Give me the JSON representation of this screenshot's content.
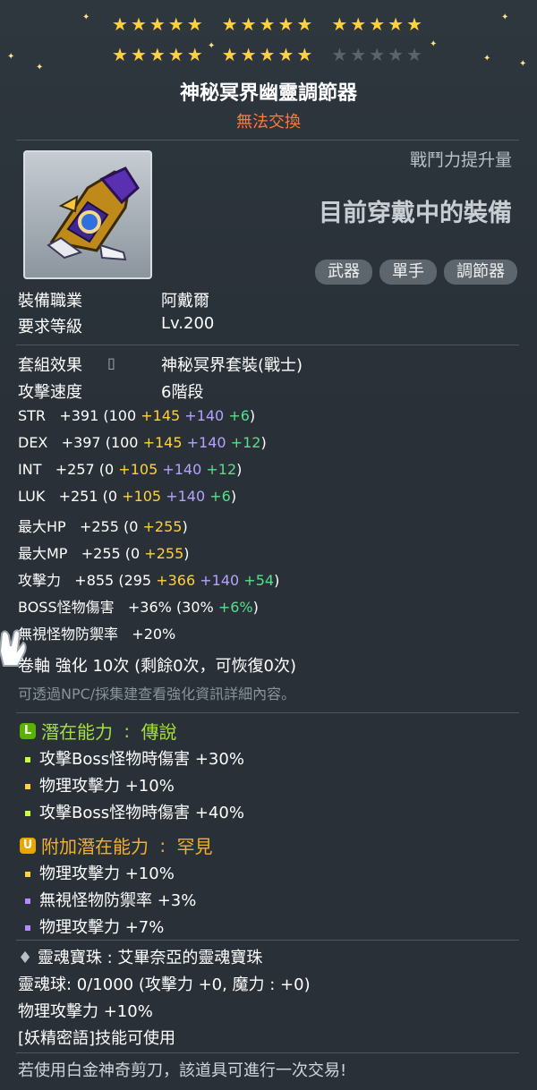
{
  "stars": {
    "row1_filled": 15,
    "row2_filled": 10,
    "row2_empty": 5
  },
  "item": {
    "name": "神秘冥界幽靈調節器",
    "trade_status": "無法交換"
  },
  "header": {
    "power_label": "戰鬥力提升量",
    "current_equipped": "目前穿戴中的裝備",
    "tags": [
      "武器",
      "單手",
      "調節器"
    ]
  },
  "requirements": {
    "job_label": "裝備職業",
    "job_value": "阿戴爾",
    "level_label": "要求等級",
    "level_value": "Lv.200"
  },
  "info": {
    "set_label": "套組效果",
    "set_value": "神秘冥界套裝(戰士)",
    "speed_label": "攻擊速度",
    "speed_value": "6階段"
  },
  "stats": [
    {
      "label": "STR",
      "total": "+391",
      "base": "(100",
      "a": "+145",
      "b": "+140",
      "c": "+6",
      "end": ")"
    },
    {
      "label": "DEX",
      "total": "+397",
      "base": "(100",
      "a": "+145",
      "b": "+140",
      "c": "+12",
      "end": ")"
    },
    {
      "label": "INT",
      "total": "+257",
      "base": "(0",
      "a": "+105",
      "b": "+140",
      "c": "+12",
      "end": ")"
    },
    {
      "label": "LUK",
      "total": "+251",
      "base": "(0",
      "a": "+105",
      "b": "+140",
      "c": "+6",
      "end": ")"
    }
  ],
  "hp": {
    "label": "最大HP",
    "total": "+255",
    "base": "(0",
    "a": "+255",
    "end": ")"
  },
  "mp": {
    "label": "最大MP",
    "total": "+255",
    "base": "(0",
    "a": "+255",
    "end": ")"
  },
  "atk": {
    "label": "攻擊力",
    "total": "+855",
    "base": "(295",
    "a": "+366",
    "b": "+140",
    "c": "+54",
    "end": ")"
  },
  "boss": {
    "label": "BOSS怪物傷害",
    "total": "+36%",
    "base": "(30%",
    "c": "+6%",
    "end": ")"
  },
  "ignore_def": {
    "label": "無視怪物防禦率",
    "total": "+20%"
  },
  "scroll": {
    "text": "卷軸 強化 10次 (剩餘0次，可恢復0次)",
    "hint": "可透過NPC/採集建查看強化資訊詳細內容。"
  },
  "potential": {
    "title": "潛在能力",
    "grade": "傳說",
    "lines": [
      "攻擊Boss怪物時傷害 +30%",
      "物理攻擊力 +10%",
      "攻擊Boss怪物時傷害 +40%"
    ]
  },
  "additional": {
    "title": "附加潛在能力",
    "grade": "罕見",
    "lines": [
      "物理攻擊力 +10%",
      "無視怪物防禦率 +3%",
      "物理攻擊力 +7%"
    ]
  },
  "soul": {
    "title": "靈魂寶珠 : 艾畢奈亞的靈魂寶珠",
    "count": "靈魂球: 0/1000 (攻擊力 +0, 魔力 : +0)",
    "effect": "物理攻擊力 +10%",
    "skill": "[妖精密語]技能可使用"
  },
  "footer": "若使用白金神奇剪刀，該道具可進行一次交易!"
}
